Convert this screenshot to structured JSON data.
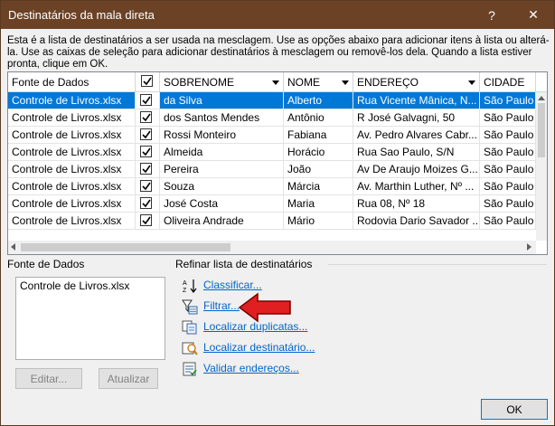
{
  "window": {
    "title": "Destinatários da mala direta",
    "help": "?",
    "close": "✕"
  },
  "description": "Esta é a lista de destinatários a ser usada na mesclagem. Use as opções abaixo para adicionar itens à lista ou alterá-la. Use as caixas de seleção para adicionar destinatários à mesclagem ou removê-los dela. Quando a lista estiver pronta, clique em OK.",
  "table": {
    "headers": [
      "Fonte de Dados",
      "",
      "SOBRENOME",
      "NOME",
      "ENDEREÇO",
      "CIDADE"
    ],
    "rows": [
      [
        "Controle de Livros.xlsx",
        "da Silva",
        "Alberto",
        "Rua Vicente Mânica, N...",
        "São Paulo"
      ],
      [
        "Controle de Livros.xlsx",
        "dos Santos Mendes",
        "Antônio",
        "R José Galvagni, 50",
        "São Paulo"
      ],
      [
        "Controle de Livros.xlsx",
        "Rossi Monteiro",
        "Fabiana",
        "Av. Pedro Alvares Cabr...",
        "São Paulo"
      ],
      [
        "Controle de Livros.xlsx",
        "Almeida",
        "Horácio",
        "Rua Sao Paulo, S/N",
        "São Paulo"
      ],
      [
        "Controle de Livros.xlsx",
        "Pereira",
        "João",
        "Av De Araujo Moizes G...",
        "São Paulo"
      ],
      [
        "Controle de Livros.xlsx",
        "Souza",
        "Márcia",
        "Av. Marthin Luther, Nº ...",
        "São Paulo"
      ],
      [
        "Controle de Livros.xlsx",
        "José Costa",
        "Maria",
        "Rua 08, Nº 18",
        "São Paulo"
      ],
      [
        "Controle de Livros.xlsx",
        "Oliveira Andrade",
        "Mário",
        "Rodovia Dario Savador ...",
        "São Paulo"
      ]
    ]
  },
  "source": {
    "label": "Fonte de Dados",
    "items": [
      "Controle de Livros.xlsx"
    ],
    "edit": "Editar...",
    "refresh": "Atualizar"
  },
  "refine": {
    "label": "Refinar lista de destinatários",
    "links": [
      "Classificar...",
      "Filtrar...",
      "Localizar duplicatas...",
      "Localizar destinatário...",
      "Validar endereços..."
    ]
  },
  "ok": "OK",
  "colors": {
    "titlebar": "#6b4226",
    "selection": "#0078d7",
    "link": "#0066cc",
    "arrow": "#e02020"
  }
}
